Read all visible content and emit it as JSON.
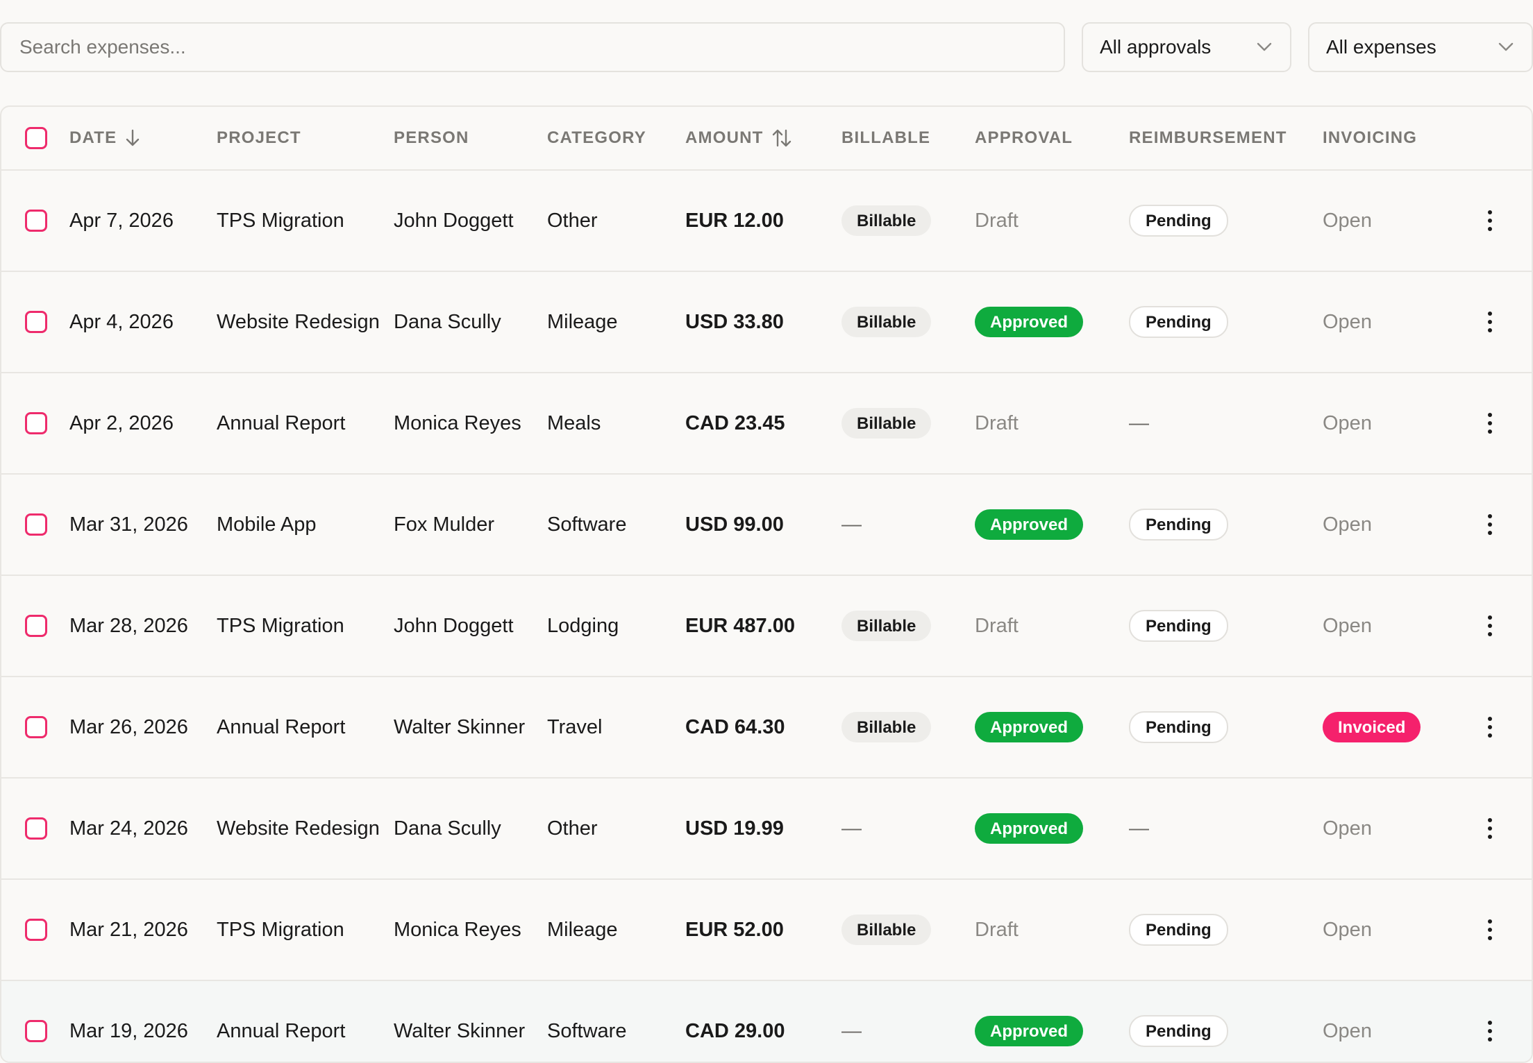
{
  "search": {
    "placeholder": "Search expenses..."
  },
  "filters": {
    "approvals": {
      "selected": "All approvals",
      "icon": "chevron-down-icon"
    },
    "expenses": {
      "selected": "All expenses",
      "icon": "chevron-down-icon"
    }
  },
  "table": {
    "columns": {
      "date": "DATE",
      "project": "PROJECT",
      "person": "PERSON",
      "category": "CATEGORY",
      "amount": "AMOUNT",
      "billable": "BILLABLE",
      "approval": "APPROVAL",
      "reimbursement": "REIMBURSEMENT",
      "invoicing": "INVOICING"
    },
    "sort": {
      "date": "arrow-down-icon",
      "amount": "sort-arrows-icon"
    },
    "rows": [
      {
        "date": "Apr 7, 2026",
        "project": "TPS Migration",
        "person": "John Doggett",
        "category": "Other",
        "amount": "EUR 12.00",
        "billable": "Billable",
        "approval": "Draft",
        "reimbursement": "Pending",
        "invoicing": "Open"
      },
      {
        "date": "Apr 4, 2026",
        "project": "Website Redesign",
        "person": "Dana Scully",
        "category": "Mileage",
        "amount": "USD 33.80",
        "billable": "Billable",
        "approval": "Approved",
        "reimbursement": "Pending",
        "invoicing": "Open"
      },
      {
        "date": "Apr 2, 2026",
        "project": "Annual Report",
        "person": "Monica Reyes",
        "category": "Meals",
        "amount": "CAD 23.45",
        "billable": "Billable",
        "approval": "Draft",
        "reimbursement": "—",
        "invoicing": "Open"
      },
      {
        "date": "Mar 31, 2026",
        "project": "Mobile App",
        "person": "Fox Mulder",
        "category": "Software",
        "amount": "USD 99.00",
        "billable": "—",
        "approval": "Approved",
        "reimbursement": "Pending",
        "invoicing": "Open"
      },
      {
        "date": "Mar 28, 2026",
        "project": "TPS Migration",
        "person": "John Doggett",
        "category": "Lodging",
        "amount": "EUR 487.00",
        "billable": "Billable",
        "approval": "Draft",
        "reimbursement": "Pending",
        "invoicing": "Open"
      },
      {
        "date": "Mar 26, 2026",
        "project": "Annual Report",
        "person": "Walter Skinner",
        "category": "Travel",
        "amount": "CAD 64.30",
        "billable": "Billable",
        "approval": "Approved",
        "reimbursement": "Pending",
        "invoicing": "Invoiced"
      },
      {
        "date": "Mar 24, 2026",
        "project": "Website Redesign",
        "person": "Dana Scully",
        "category": "Other",
        "amount": "USD 19.99",
        "billable": "—",
        "approval": "Approved",
        "reimbursement": "—",
        "invoicing": "Open"
      },
      {
        "date": "Mar 21, 2026",
        "project": "TPS Migration",
        "person": "Monica Reyes",
        "category": "Mileage",
        "amount": "EUR 52.00",
        "billable": "Billable",
        "approval": "Draft",
        "reimbursement": "Pending",
        "invoicing": "Open"
      },
      {
        "date": "Mar 19, 2026",
        "project": "Annual Report",
        "person": "Walter Skinner",
        "category": "Software",
        "amount": "CAD 29.00",
        "billable": "—",
        "approval": "Approved",
        "reimbursement": "Pending",
        "invoicing": "Open"
      }
    ]
  },
  "colors": {
    "accent": "#ee2b6c",
    "approved": "#0fab3e",
    "invoiced": "#f5216c",
    "muted_text": "#8a8884"
  }
}
